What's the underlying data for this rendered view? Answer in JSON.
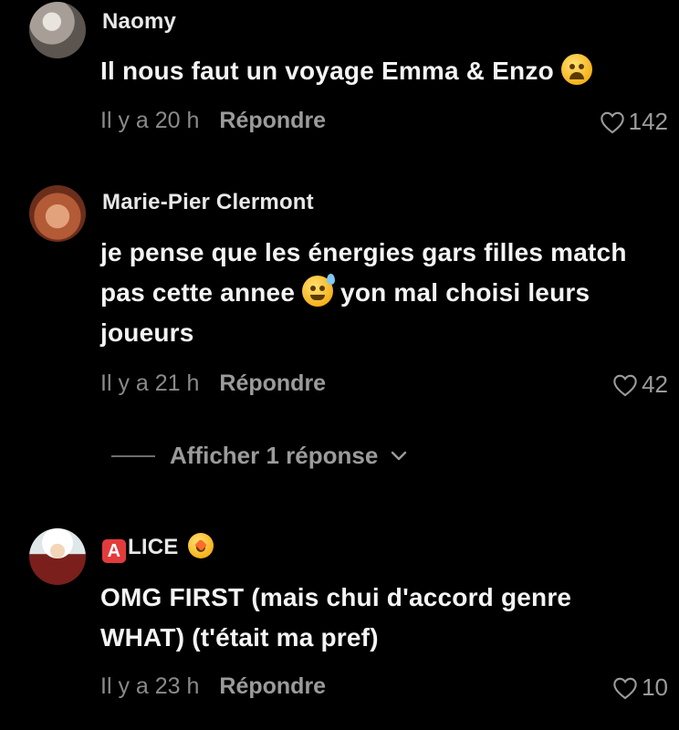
{
  "comments": [
    {
      "username": "Naomy",
      "text_before": "Il nous faut un voyage Emma & Enzo ",
      "emoji_1": "weary-face-emoji",
      "text_after": "",
      "time": "Il y a 20 h",
      "reply_label": "Répondre",
      "likes": "142"
    },
    {
      "username": "Marie-Pier Clermont",
      "text_before": "je pense que les énergies gars filles match pas cette annee ",
      "emoji_1": "grinning-sweat-emoji",
      "text_after": " yon mal choisi leurs joueurs",
      "time": "Il y a 21 h",
      "reply_label": "Répondre",
      "likes": "42"
    },
    {
      "username_badge": "A",
      "username": "LICE",
      "username_emoji": "star-struck-emoji",
      "text_before": "OMG FIRST (mais chui d'accord genre WHAT) (t'était ma pref)",
      "time": "Il y a 23 h",
      "reply_label": "Répondre",
      "likes": "10"
    }
  ],
  "view_replies": {
    "label": "Afficher 1 réponse"
  },
  "colors": {
    "background": "#000000",
    "muted": "#9b9b9b",
    "text": "#f4f4f4"
  }
}
